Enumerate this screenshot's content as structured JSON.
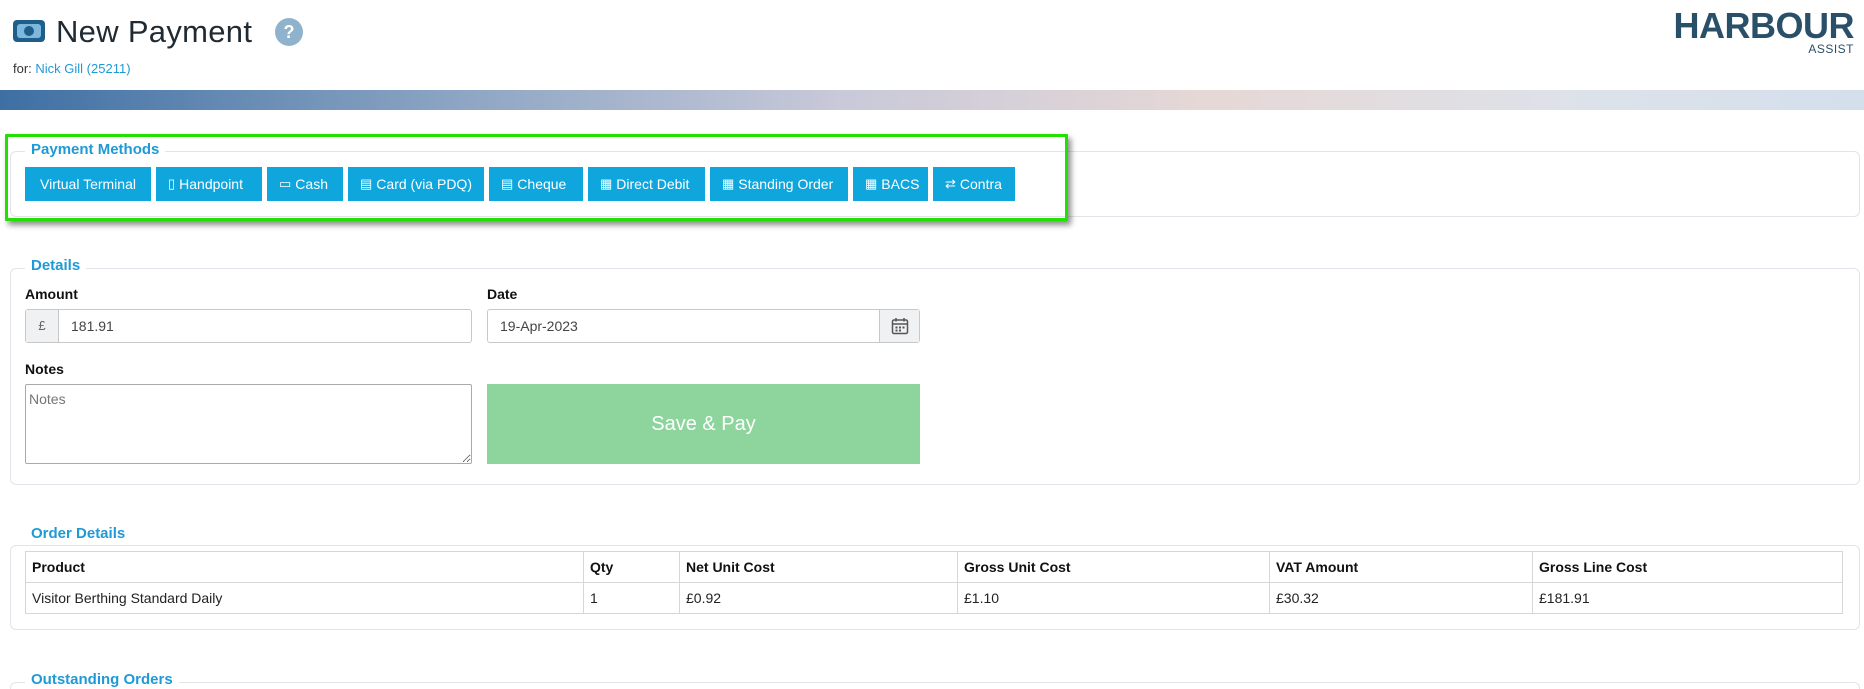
{
  "header": {
    "title": "New Payment",
    "help_glyph": "?",
    "for_prefix": "for: ",
    "member_link": "Nick Gill (25211)",
    "brand_name": "HARBOUR",
    "brand_sub": "ASSIST",
    "title_icon": "money-icon"
  },
  "payment_methods": {
    "legend": "Payment Methods",
    "buttons": [
      {
        "label": "Virtual Terminal",
        "icon": ""
      },
      {
        "label": "Handpoint",
        "icon": "mobile-terminal-icon"
      },
      {
        "label": "Cash",
        "icon": "cash-icon"
      },
      {
        "label": "Card (via PDQ)",
        "icon": "credit-card-icon"
      },
      {
        "label": "Cheque",
        "icon": "cheque-icon"
      },
      {
        "label": "Direct Debit",
        "icon": "calendar-icon"
      },
      {
        "label": "Standing Order",
        "icon": "calendar-icon"
      },
      {
        "label": "BACS",
        "icon": "calendar-icon"
      },
      {
        "label": "Contra",
        "icon": "swap-icon"
      }
    ],
    "highlight_color": "#22e000"
  },
  "details": {
    "legend": "Details",
    "amount_label": "Amount",
    "currency_symbol": "£",
    "amount_value": "181.91",
    "date_label": "Date",
    "date_value": "19-Apr-2023",
    "notes_label": "Notes",
    "notes_placeholder": "Notes",
    "save_label": "Save & Pay"
  },
  "order_details": {
    "legend": "Order Details",
    "columns": [
      "Product",
      "Qty",
      "Net Unit Cost",
      "Gross Unit Cost",
      "VAT Amount",
      "Gross Line Cost"
    ],
    "rows": [
      [
        "Visitor Berthing Standard Daily",
        "1",
        "£0.92",
        "£1.10",
        "£30.32",
        "£181.91"
      ]
    ]
  },
  "outstanding_orders": {
    "legend": "Outstanding Orders"
  },
  "colors": {
    "accent": "#0fa6dd",
    "legend": "#1f9ad6",
    "save_button": "#8dd59c",
    "brand": "#2a4f68"
  }
}
